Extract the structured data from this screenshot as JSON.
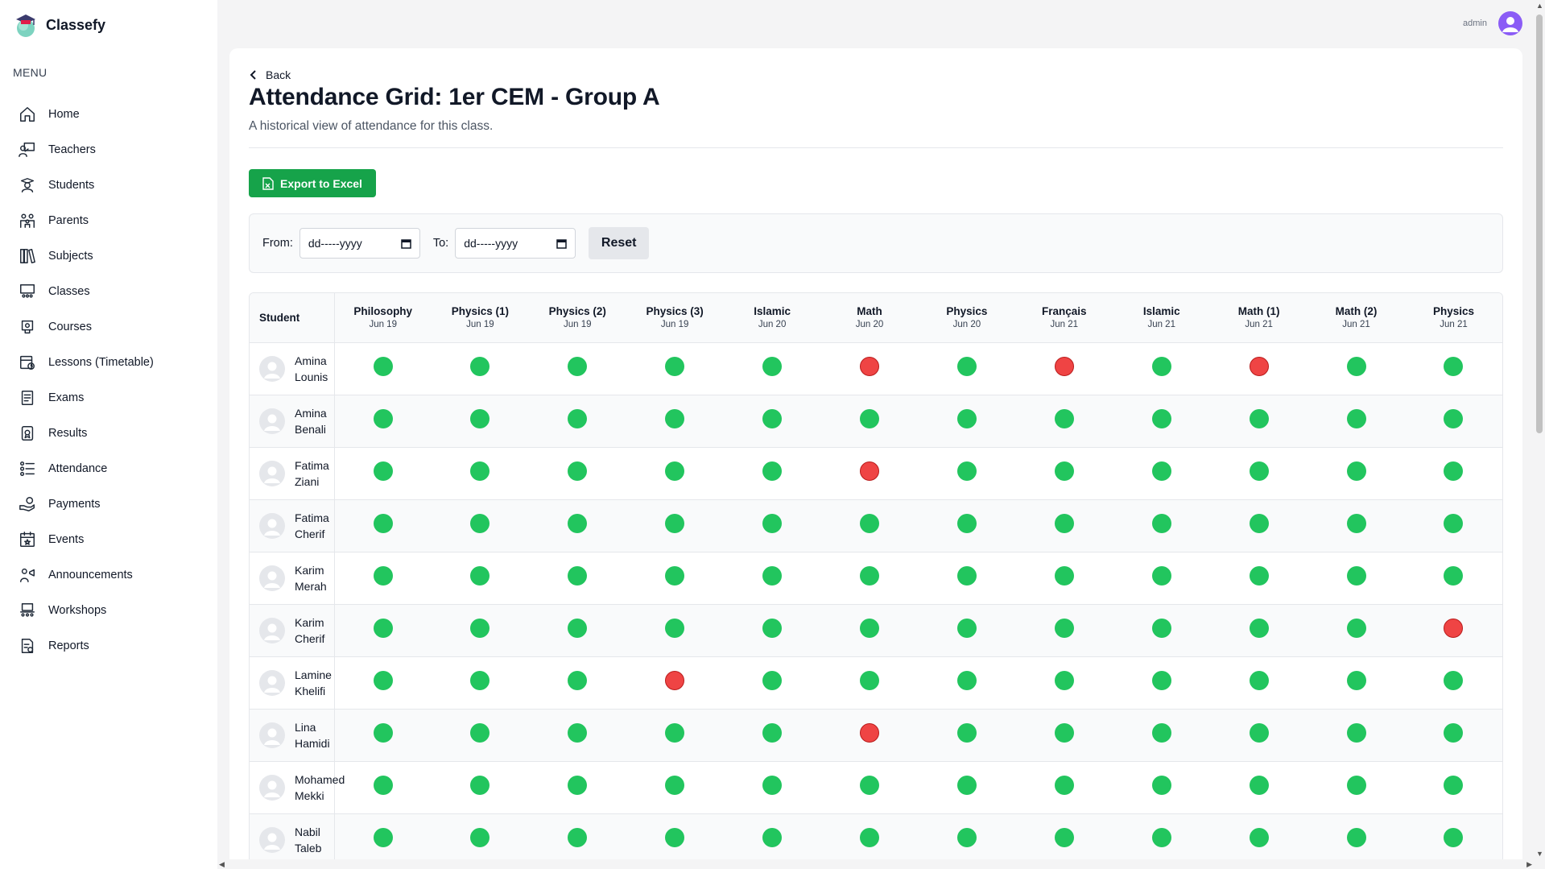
{
  "brand": {
    "name": "Classefy"
  },
  "sidebar": {
    "menu_heading": "MENU",
    "items": [
      {
        "label": "Home",
        "icon": "home-icon"
      },
      {
        "label": "Teachers",
        "icon": "teacher-icon"
      },
      {
        "label": "Students",
        "icon": "student-icon"
      },
      {
        "label": "Parents",
        "icon": "parents-icon"
      },
      {
        "label": "Subjects",
        "icon": "books-icon"
      },
      {
        "label": "Classes",
        "icon": "classroom-icon"
      },
      {
        "label": "Courses",
        "icon": "courses-icon"
      },
      {
        "label": "Lessons (Timetable)",
        "icon": "calendar-clock-icon"
      },
      {
        "label": "Exams",
        "icon": "exam-icon"
      },
      {
        "label": "Results",
        "icon": "results-icon"
      },
      {
        "label": "Attendance",
        "icon": "attendance-icon"
      },
      {
        "label": "Payments",
        "icon": "payments-icon"
      },
      {
        "label": "Events",
        "icon": "calendar-star-icon"
      },
      {
        "label": "Announcements",
        "icon": "megaphone-icon"
      },
      {
        "label": "Workshops",
        "icon": "workshop-icon"
      },
      {
        "label": "Reports",
        "icon": "report-icon"
      }
    ]
  },
  "header": {
    "username": "admin",
    "accent_color": "#8b5cf6"
  },
  "page": {
    "back_label": "Back",
    "title": "Attendance Grid: 1er CEM - Group A",
    "subtitle": "A historical view of attendance for this class.",
    "export_label": "Export to Excel"
  },
  "filters": {
    "from_label": "From:",
    "to_label": "To:",
    "from_value": "dd-----yyyy",
    "to_value": "dd-----yyyy",
    "reset_label": "Reset"
  },
  "table": {
    "student_header": "Student",
    "columns": [
      {
        "subject": "Philosophy",
        "date": "Jun 19"
      },
      {
        "subject": "Physics (1)",
        "date": "Jun 19"
      },
      {
        "subject": "Physics (2)",
        "date": "Jun 19"
      },
      {
        "subject": "Physics (3)",
        "date": "Jun 19"
      },
      {
        "subject": "Islamic",
        "date": "Jun 20"
      },
      {
        "subject": "Math",
        "date": "Jun 20"
      },
      {
        "subject": "Physics",
        "date": "Jun 20"
      },
      {
        "subject": "Français",
        "date": "Jun 21"
      },
      {
        "subject": "Islamic",
        "date": "Jun 21"
      },
      {
        "subject": "Math (1)",
        "date": "Jun 21"
      },
      {
        "subject": "Math (2)",
        "date": "Jun 21"
      },
      {
        "subject": "Physics",
        "date": "Jun 21"
      }
    ],
    "rows": [
      {
        "first": "Amina",
        "last": "Lounis",
        "attendance": [
          "present",
          "present",
          "present",
          "present",
          "present",
          "absent",
          "present",
          "absent",
          "present",
          "absent",
          "present",
          "present"
        ]
      },
      {
        "first": "Amina",
        "last": "Benali",
        "attendance": [
          "present",
          "present",
          "present",
          "present",
          "present",
          "present",
          "present",
          "present",
          "present",
          "present",
          "present",
          "present"
        ]
      },
      {
        "first": "Fatima",
        "last": "Ziani",
        "attendance": [
          "present",
          "present",
          "present",
          "present",
          "present",
          "absent",
          "present",
          "present",
          "present",
          "present",
          "present",
          "present"
        ]
      },
      {
        "first": "Fatima",
        "last": "Cherif",
        "attendance": [
          "present",
          "present",
          "present",
          "present",
          "present",
          "present",
          "present",
          "present",
          "present",
          "present",
          "present",
          "present"
        ]
      },
      {
        "first": "Karim",
        "last": "Merah",
        "attendance": [
          "present",
          "present",
          "present",
          "present",
          "present",
          "present",
          "present",
          "present",
          "present",
          "present",
          "present",
          "present"
        ]
      },
      {
        "first": "Karim",
        "last": "Cherif",
        "attendance": [
          "present",
          "present",
          "present",
          "present",
          "present",
          "present",
          "present",
          "present",
          "present",
          "present",
          "present",
          "absent"
        ]
      },
      {
        "first": "Lamine",
        "last": "Khelifi",
        "attendance": [
          "present",
          "present",
          "present",
          "absent",
          "present",
          "present",
          "present",
          "present",
          "present",
          "present",
          "present",
          "present"
        ]
      },
      {
        "first": "Lina",
        "last": "Hamidi",
        "attendance": [
          "present",
          "present",
          "present",
          "present",
          "present",
          "absent",
          "present",
          "present",
          "present",
          "present",
          "present",
          "present"
        ]
      },
      {
        "first": "Mohamed",
        "last": "Mekki",
        "attendance": [
          "present",
          "present",
          "present",
          "present",
          "present",
          "present",
          "present",
          "present",
          "present",
          "present",
          "present",
          "present"
        ]
      },
      {
        "first": "Nabil",
        "last": "Taleb",
        "attendance": [
          "present",
          "present",
          "present",
          "present",
          "present",
          "present",
          "present",
          "present",
          "present",
          "present",
          "present",
          "present"
        ]
      }
    ]
  },
  "colors": {
    "present": "#22c55e",
    "absent": "#ef4444",
    "export_button": "#16a34a"
  }
}
